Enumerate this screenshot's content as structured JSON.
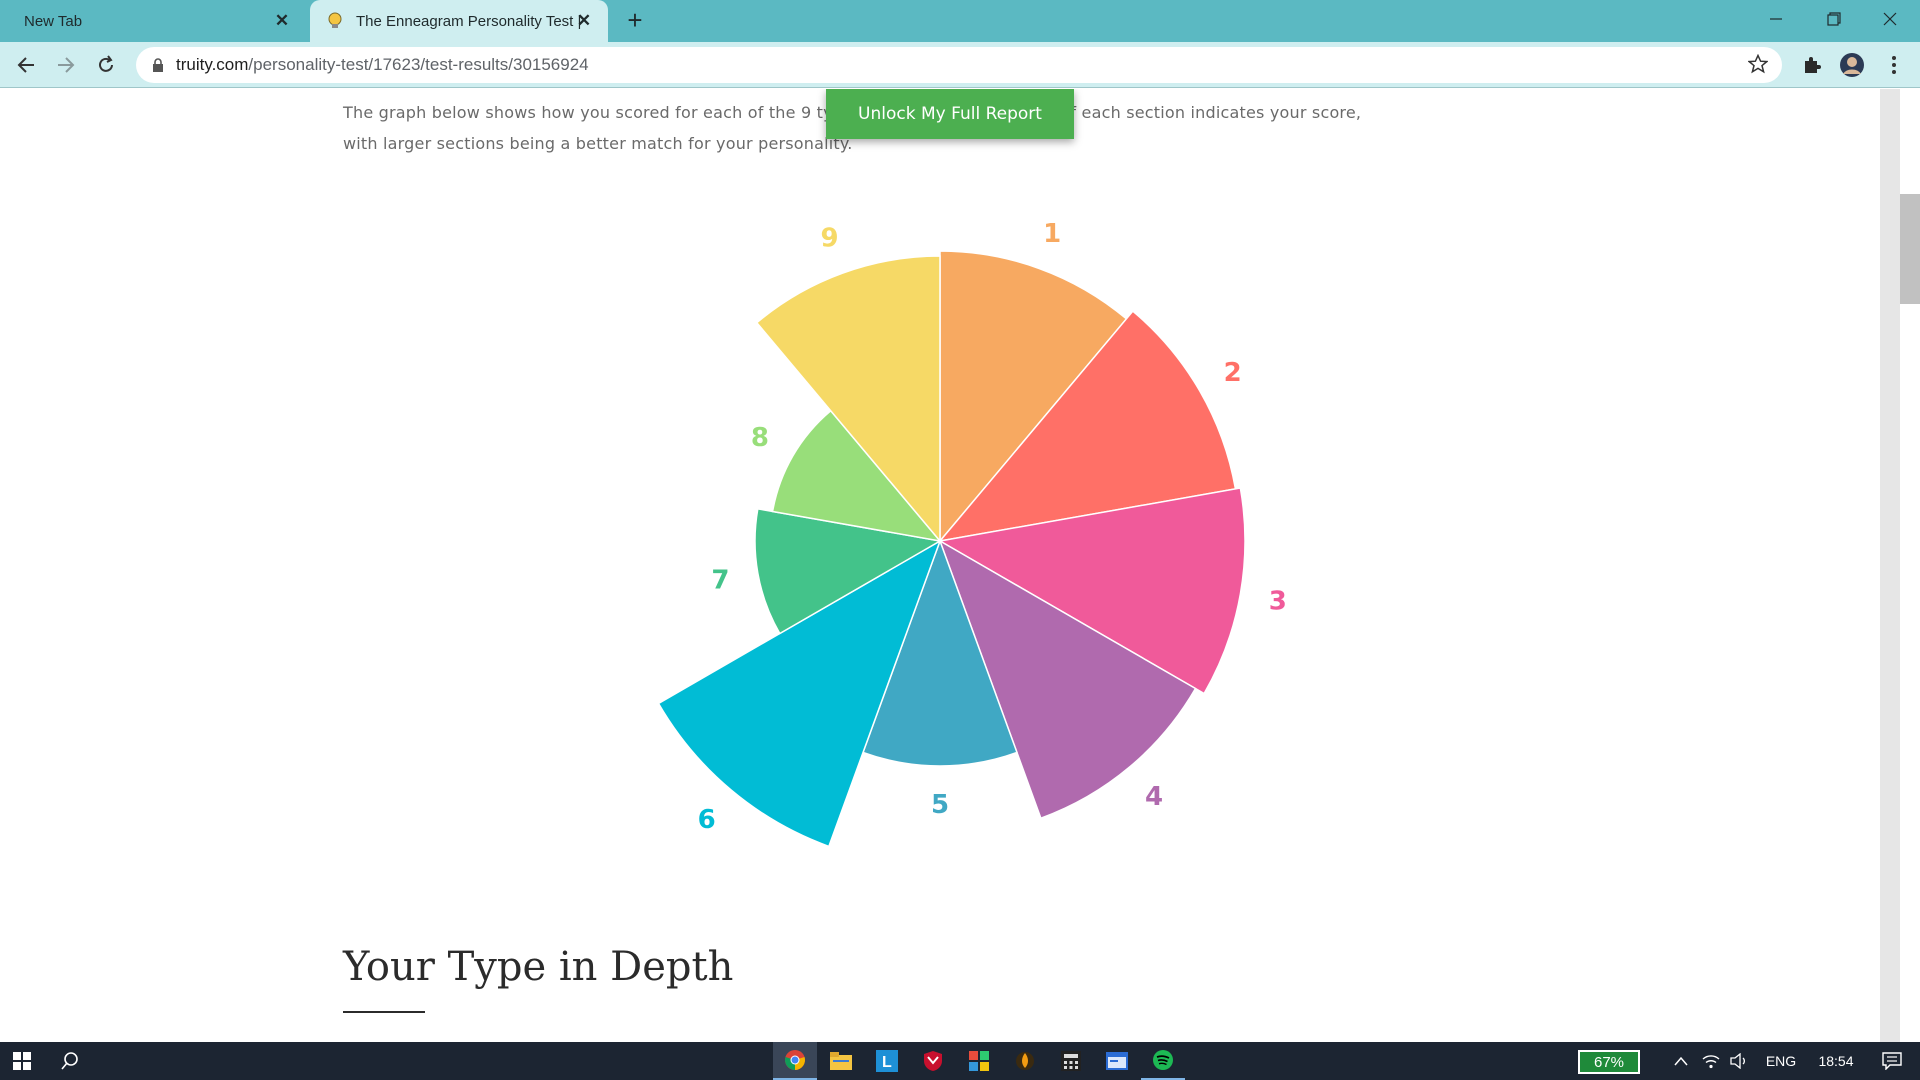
{
  "browser": {
    "tabs": [
      {
        "label": "New Tab",
        "active": false
      },
      {
        "label": "The Enneagram Personality Test |",
        "active": true
      }
    ],
    "url": {
      "host": "truity.com",
      "path": "/personality-test/17623/test-results/30156924"
    }
  },
  "page": {
    "intro_line1": "The graph below shows how you scored for each of the 9 types. In this graph, the area of each section indicates your score,",
    "intro_line2": "with larger sections being a better match for your personality.",
    "unlock_button": "Unlock My Full Report",
    "section_heading": "Your Type in Depth"
  },
  "chart_data": {
    "type": "polar-area",
    "categories": [
      "1",
      "2",
      "3",
      "4",
      "5",
      "6",
      "7",
      "8",
      "9"
    ],
    "values": [
      290,
      300,
      305,
      295,
      225,
      325,
      185,
      170,
      285
    ],
    "colors": [
      "#f7a961",
      "#ff7067",
      "#f05a9a",
      "#b06aae",
      "#40a8c4",
      "#01bcd5",
      "#43c38a",
      "#98de7a",
      "#f6d966"
    ],
    "label_colors": [
      "#f7a961",
      "#ff7067",
      "#f05a9a",
      "#b06aae",
      "#40a8c4",
      "#01bcd5",
      "#43c38a",
      "#98de7a",
      "#f6d966"
    ]
  },
  "taskbar": {
    "battery": "67%",
    "language": "ENG",
    "time": "18:54"
  }
}
